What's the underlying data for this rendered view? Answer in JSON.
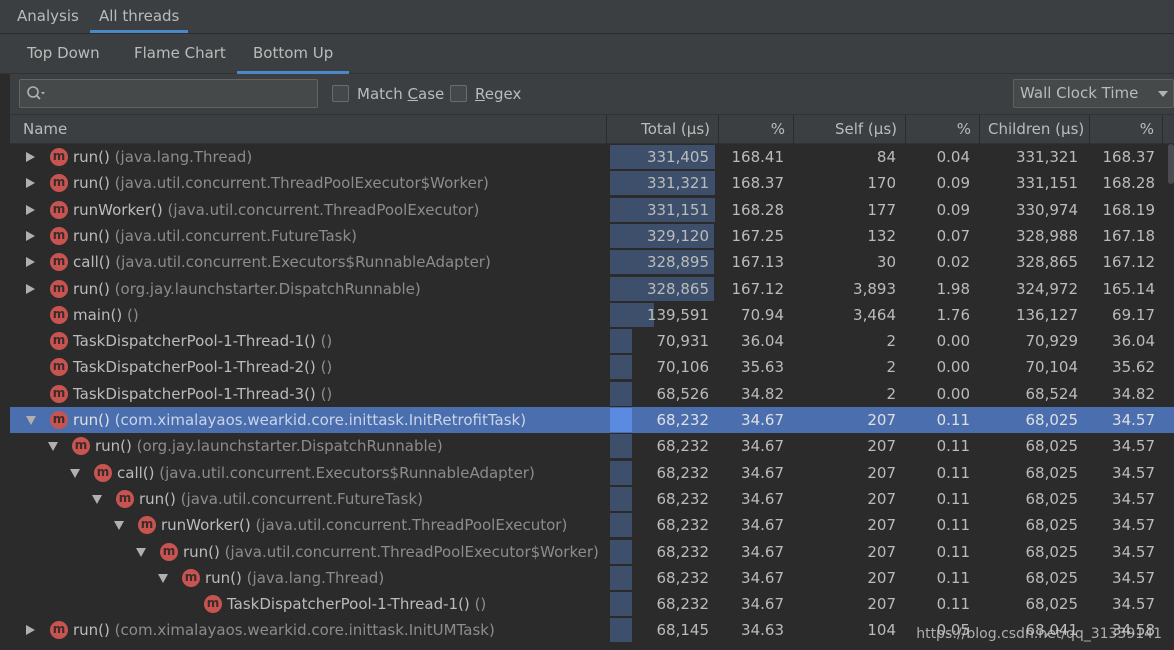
{
  "top_tabs": [
    {
      "label": "Analysis",
      "active": false
    },
    {
      "label": "All threads",
      "active": true
    }
  ],
  "view_tabs": [
    {
      "label": "Top Down",
      "active": false
    },
    {
      "label": "Flame Chart",
      "active": false
    },
    {
      "label": "Bottom Up",
      "active": true
    }
  ],
  "toolbar": {
    "search_placeholder": "",
    "search_icon": "search-icon",
    "match_case_label_pre": "Match ",
    "match_case_label_u": "C",
    "match_case_label_post": "ase",
    "match_case_checked": false,
    "regex_label_pre": "",
    "regex_label_u": "R",
    "regex_label_post": "egex",
    "regex_checked": false,
    "clock_select": "Wall Clock Time"
  },
  "columns": {
    "name": "Name",
    "total": "Total (μs)",
    "total_pct": "%",
    "self": "Self (μs)",
    "self_pct": "%",
    "children": "Children (μs)",
    "children_pct": "%"
  },
  "rows": [
    {
      "expander": "collapsed",
      "depth": 0,
      "method": "run()",
      "pkg": "(java.lang.Thread)",
      "total": "331,405",
      "total_pct": "168.41",
      "self": "84",
      "self_pct": "0.04",
      "children": "331,321",
      "children_pct": "168.37",
      "fraction": 1.0
    },
    {
      "expander": "collapsed",
      "depth": 0,
      "method": "run()",
      "pkg": "(java.util.concurrent.ThreadPoolExecutor$Worker)",
      "total": "331,321",
      "total_pct": "168.37",
      "self": "170",
      "self_pct": "0.09",
      "children": "331,151",
      "children_pct": "168.28",
      "fraction": 0.9997
    },
    {
      "expander": "collapsed",
      "depth": 0,
      "method": "runWorker()",
      "pkg": "(java.util.concurrent.ThreadPoolExecutor)",
      "total": "331,151",
      "total_pct": "168.28",
      "self": "177",
      "self_pct": "0.09",
      "children": "330,974",
      "children_pct": "168.19",
      "fraction": 0.9992
    },
    {
      "expander": "collapsed",
      "depth": 0,
      "method": "run()",
      "pkg": "(java.util.concurrent.FutureTask)",
      "total": "329,120",
      "total_pct": "167.25",
      "self": "132",
      "self_pct": "0.07",
      "children": "328,988",
      "children_pct": "167.18",
      "fraction": 0.9931
    },
    {
      "expander": "collapsed",
      "depth": 0,
      "method": "call()",
      "pkg": "(java.util.concurrent.Executors$RunnableAdapter)",
      "total": "328,895",
      "total_pct": "167.13",
      "self": "30",
      "self_pct": "0.02",
      "children": "328,865",
      "children_pct": "167.12",
      "fraction": 0.9924
    },
    {
      "expander": "collapsed",
      "depth": 0,
      "method": "run()",
      "pkg": "(org.jay.launchstarter.DispatchRunnable)",
      "total": "328,865",
      "total_pct": "167.12",
      "self": "3,893",
      "self_pct": "1.98",
      "children": "324,972",
      "children_pct": "165.14",
      "fraction": 0.9923
    },
    {
      "expander": "none",
      "depth": 0,
      "method": "main()",
      "pkg": "()",
      "total": "139,591",
      "total_pct": "70.94",
      "self": "3,464",
      "self_pct": "1.76",
      "children": "136,127",
      "children_pct": "69.17",
      "fraction": 0.4212
    },
    {
      "expander": "none",
      "depth": 0,
      "method": "TaskDispatcherPool-1-Thread-1()",
      "pkg": "()",
      "total": "70,931",
      "total_pct": "36.04",
      "self": "2",
      "self_pct": "0.00",
      "children": "70,929",
      "children_pct": "36.04",
      "fraction": 0.214
    },
    {
      "expander": "none",
      "depth": 0,
      "method": "TaskDispatcherPool-1-Thread-2()",
      "pkg": "()",
      "total": "70,106",
      "total_pct": "35.63",
      "self": "2",
      "self_pct": "0.00",
      "children": "70,104",
      "children_pct": "35.62",
      "fraction": 0.2115
    },
    {
      "expander": "none",
      "depth": 0,
      "method": "TaskDispatcherPool-1-Thread-3()",
      "pkg": "()",
      "total": "68,526",
      "total_pct": "34.82",
      "self": "2",
      "self_pct": "0.00",
      "children": "68,524",
      "children_pct": "34.82",
      "fraction": 0.2068
    },
    {
      "expander": "expanded",
      "depth": 0,
      "method": "run()",
      "pkg": "(com.ximalayaos.wearkid.core.inittask.InitRetrofitTask)",
      "total": "68,232",
      "total_pct": "34.67",
      "self": "207",
      "self_pct": "0.11",
      "children": "68,025",
      "children_pct": "34.57",
      "fraction": 0.2059,
      "selected": true
    },
    {
      "expander": "expanded",
      "depth": 1,
      "method": "run()",
      "pkg": "(org.jay.launchstarter.DispatchRunnable)",
      "total": "68,232",
      "total_pct": "34.67",
      "self": "207",
      "self_pct": "0.11",
      "children": "68,025",
      "children_pct": "34.57",
      "fraction": 0.2059
    },
    {
      "expander": "expanded",
      "depth": 2,
      "method": "call()",
      "pkg": "(java.util.concurrent.Executors$RunnableAdapter)",
      "total": "68,232",
      "total_pct": "34.67",
      "self": "207",
      "self_pct": "0.11",
      "children": "68,025",
      "children_pct": "34.57",
      "fraction": 0.2059
    },
    {
      "expander": "expanded",
      "depth": 3,
      "method": "run()",
      "pkg": "(java.util.concurrent.FutureTask)",
      "total": "68,232",
      "total_pct": "34.67",
      "self": "207",
      "self_pct": "0.11",
      "children": "68,025",
      "children_pct": "34.57",
      "fraction": 0.2059
    },
    {
      "expander": "expanded",
      "depth": 4,
      "method": "runWorker()",
      "pkg": "(java.util.concurrent.ThreadPoolExecutor)",
      "total": "68,232",
      "total_pct": "34.67",
      "self": "207",
      "self_pct": "0.11",
      "children": "68,025",
      "children_pct": "34.57",
      "fraction": 0.2059
    },
    {
      "expander": "expanded",
      "depth": 5,
      "method": "run()",
      "pkg": "(java.util.concurrent.ThreadPoolExecutor$Worker)",
      "total": "68,232",
      "total_pct": "34.67",
      "self": "207",
      "self_pct": "0.11",
      "children": "68,025",
      "children_pct": "34.57",
      "fraction": 0.2059
    },
    {
      "expander": "expanded",
      "depth": 6,
      "method": "run()",
      "pkg": "(java.lang.Thread)",
      "total": "68,232",
      "total_pct": "34.67",
      "self": "207",
      "self_pct": "0.11",
      "children": "68,025",
      "children_pct": "34.57",
      "fraction": 0.2059
    },
    {
      "expander": "none",
      "depth": 7,
      "method": "TaskDispatcherPool-1-Thread-1()",
      "pkg": "()",
      "total": "68,232",
      "total_pct": "34.67",
      "self": "207",
      "self_pct": "0.11",
      "children": "68,025",
      "children_pct": "34.57",
      "fraction": 0.2059
    },
    {
      "expander": "collapsed",
      "depth": 0,
      "method": "run()",
      "pkg": "(com.ximalayaos.wearkid.core.inittask.InitUMTask)",
      "total": "68,145",
      "total_pct": "34.63",
      "self": "104",
      "self_pct": "0.05",
      "children": "68,041",
      "children_pct": "34.58",
      "fraction": 0.2056
    }
  ],
  "watermark": "https://blog.csdn.net/qq_31339141",
  "colors": {
    "accent": "#4a88c7",
    "selection": "#4b6eaf",
    "method_icon": "#c75450",
    "bar": "#3d4f6a"
  }
}
